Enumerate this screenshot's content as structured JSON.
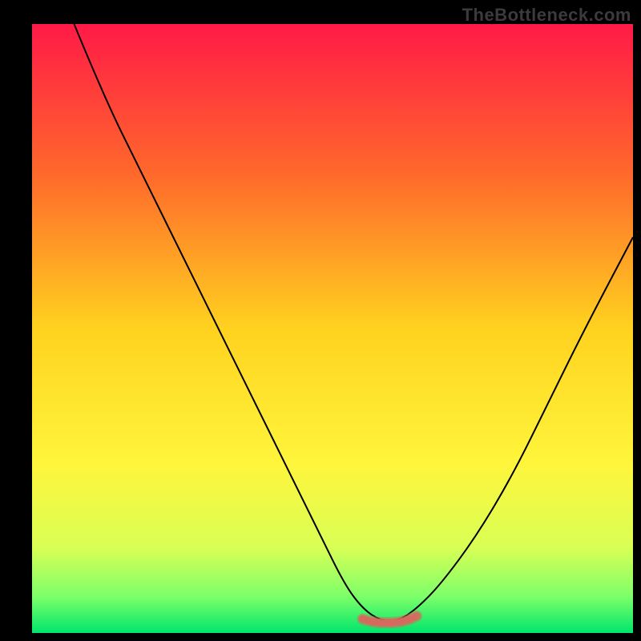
{
  "watermark": "TheBottleneck.com",
  "chart_data": {
    "type": "line",
    "title": "",
    "xlabel": "",
    "ylabel": "",
    "xlim": [
      0,
      100
    ],
    "ylim": [
      0,
      100
    ],
    "grid": false,
    "legend": false,
    "annotations": [],
    "background_gradient_stops": [
      {
        "offset": 0.0,
        "color": "#ff1a47"
      },
      {
        "offset": 0.25,
        "color": "#ff6a2b"
      },
      {
        "offset": 0.5,
        "color": "#ffd21f"
      },
      {
        "offset": 0.72,
        "color": "#fff53b"
      },
      {
        "offset": 0.86,
        "color": "#d9ff55"
      },
      {
        "offset": 0.94,
        "color": "#7dff6a"
      },
      {
        "offset": 1.0,
        "color": "#00e66b"
      }
    ],
    "series": [
      {
        "name": "curve",
        "color": "#000000",
        "x": [
          7,
          12,
          18,
          24,
          30,
          36,
          42,
          48,
          52,
          55,
          58,
          61,
          64,
          68,
          74,
          80,
          86,
          92,
          100
        ],
        "values": [
          100,
          88,
          76,
          64,
          52,
          40,
          28,
          16,
          8,
          4,
          2,
          2,
          4,
          8,
          16,
          26,
          38,
          50,
          65
        ]
      },
      {
        "name": "flat-segment-marker",
        "color": "#d66a5e",
        "x": [
          55,
          56,
          57,
          58,
          59,
          60,
          61,
          62,
          63,
          64
        ],
        "values": [
          2.3,
          2.0,
          1.8,
          1.7,
          1.7,
          1.7,
          1.8,
          2.0,
          2.3,
          2.8
        ]
      }
    ]
  }
}
